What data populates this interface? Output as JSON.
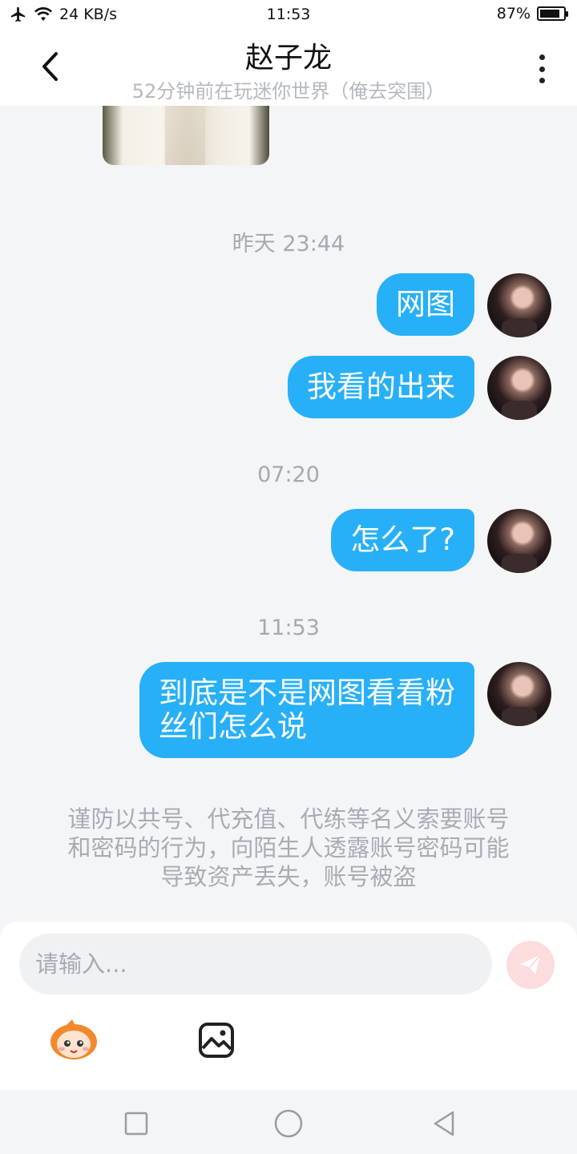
{
  "status_bar": {
    "network_speed": "24 KB/s",
    "time": "11:53",
    "battery": "87%",
    "battery_level": 0.87,
    "icons": [
      "airplane-icon",
      "wifi-icon",
      "battery-icon"
    ]
  },
  "header": {
    "title": "赵子龙",
    "subtitle": "52分钟前在玩迷你世界（俺去突围）",
    "back_icon": "chevron-left-icon",
    "more_icon": "more-vertical-icon"
  },
  "messages": {
    "ts1": "昨天 23:44",
    "m1": "网图",
    "m2": "我看的出来",
    "ts2": "07:20",
    "m3": "怎么了?",
    "ts3": "11:53",
    "m4_line1": "到底是不是网图看看粉",
    "m4_line2": "丝们怎么说"
  },
  "notice": {
    "line1": "谨防以共号、代充值、代练等名义索要账号",
    "line2": "和密码的行为，向陌生人透露账号密码可能",
    "line3": "导致资产丢失，账号被盗"
  },
  "input": {
    "placeholder": "请输入...",
    "send_icon": "send-icon",
    "tools": [
      "emoji-icon",
      "image-icon"
    ]
  },
  "nav": {
    "icons": [
      "recent-apps-icon",
      "home-icon",
      "back-triangle-icon"
    ]
  },
  "colors": {
    "bubble": "#27b0f7",
    "send_button": "#fcdcdc",
    "send_arrow": "#ffffff"
  }
}
